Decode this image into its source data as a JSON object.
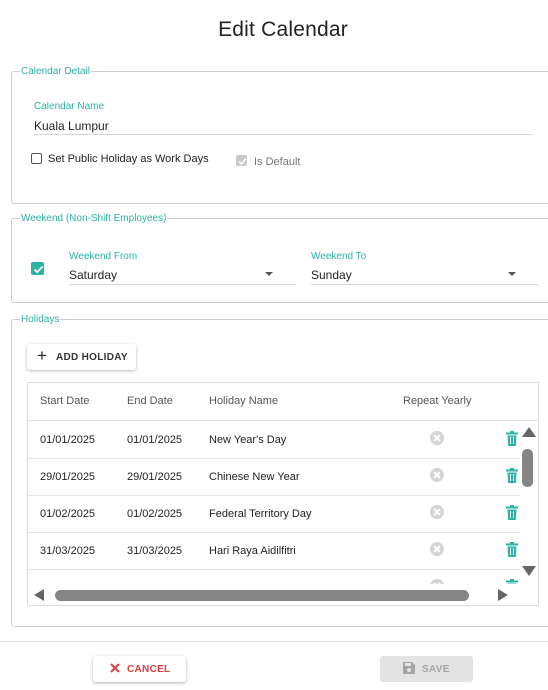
{
  "dialog": {
    "title": "Edit Calendar"
  },
  "calendar_detail": {
    "legend": "Calendar Detail",
    "name_label": "Calendar Name",
    "name_value": "Kuala Lumpur",
    "public_holiday_label": "Set Public Holiday as Work Days",
    "public_holiday_checked": false,
    "is_default_label": "Is Default",
    "is_default_checked": true
  },
  "weekend": {
    "legend": "Weekend (Non-Shift Employees)",
    "enabled": true,
    "from_label": "Weekend From",
    "from_value": "Saturday",
    "to_label": "Weekend To",
    "to_value": "Sunday"
  },
  "holidays": {
    "legend": "Holidays",
    "add_button": "ADD HOLIDAY",
    "columns": [
      "Start Date",
      "End Date",
      "Holiday Name",
      "Repeat Yearly"
    ],
    "rows": [
      {
        "start": "01/01/2025",
        "end": "01/01/2025",
        "name": "New Year's Day",
        "repeat": false
      },
      {
        "start": "29/01/2025",
        "end": "29/01/2025",
        "name": "Chinese New Year",
        "repeat": false
      },
      {
        "start": "01/02/2025",
        "end": "01/02/2025",
        "name": "Federal Territory Day",
        "repeat": false
      },
      {
        "start": "31/03/2025",
        "end": "31/03/2025",
        "name": "Hari Raya Aidilfitri",
        "repeat": false
      }
    ]
  },
  "actions": {
    "cancel": "CANCEL",
    "save": "SAVE"
  },
  "colors": {
    "accent": "#2bb3a3",
    "cancel": "#e03c3c",
    "disabled": "#a5a5a5"
  }
}
